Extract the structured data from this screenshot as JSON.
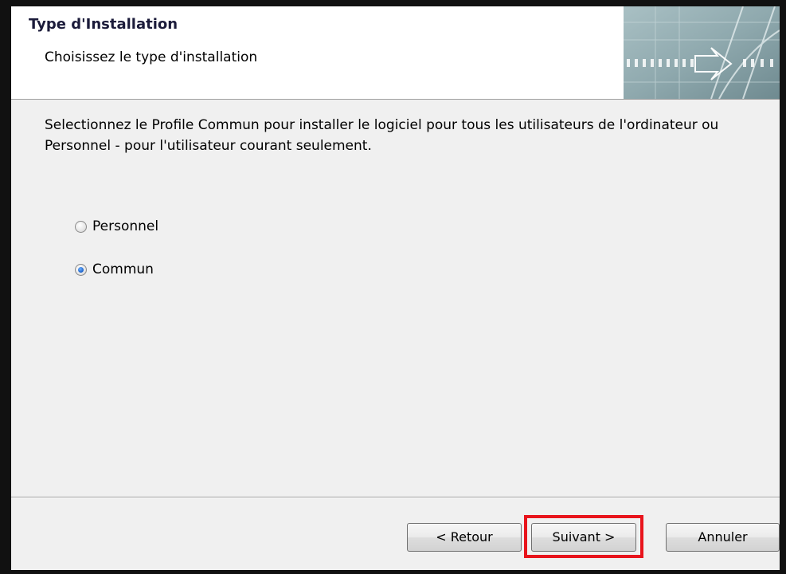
{
  "header": {
    "title": "Type d'Installation",
    "subtitle": "Choisissez le type d'installation",
    "banner_icon": "arrow-banner-graphic"
  },
  "body": {
    "description": "Selectionnez le Profile Commun pour installer le logiciel pour tous les utilisateurs de l'ordinateur ou Personnel - pour l'utilisateur courant seulement.",
    "options": [
      {
        "label": "Personnel",
        "checked": false
      },
      {
        "label": "Commun",
        "checked": true
      }
    ]
  },
  "buttons": {
    "back_label": "< Retour",
    "next_label": "Suivant >",
    "cancel_label": "Annuler"
  },
  "colors": {
    "highlight": "#e8141c",
    "dialog_bg": "#f0f0f0",
    "header_bg": "#ffffff"
  }
}
